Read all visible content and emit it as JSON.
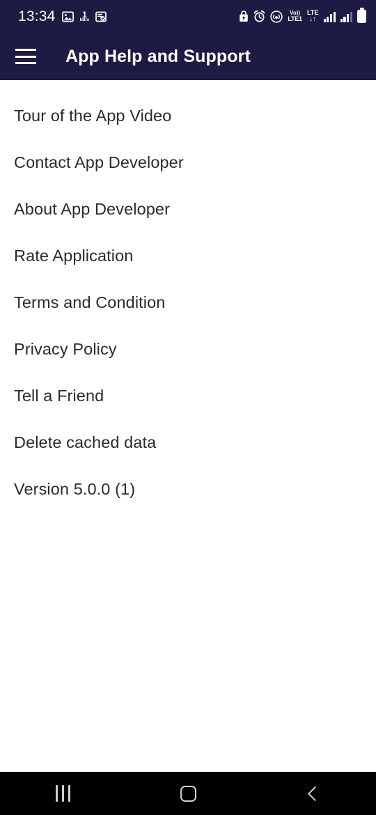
{
  "theme": {
    "header_bg": "#1d1b43",
    "header_text": "#ffffff",
    "page_bg": "#ffffff",
    "list_text": "#2b2b2b",
    "navbar_bg": "#000000",
    "navbar_icon": "#cfcfcf"
  },
  "status_bar": {
    "clock": "13:34",
    "left_icons": [
      {
        "name": "photo-icon"
      },
      {
        "name": "network-speed-indicator",
        "value": "1",
        "unit": "kB/s"
      },
      {
        "name": "document-check-icon"
      }
    ],
    "right_icons": [
      {
        "name": "lock-icon"
      },
      {
        "name": "alarm-clock-icon"
      },
      {
        "name": "hotspot-icon"
      },
      {
        "name": "volte-badge",
        "line1": "Vo))",
        "line2": "LTE1"
      },
      {
        "name": "lte-data-badge",
        "line1": "LTE",
        "line2": "↓↑"
      },
      {
        "name": "signal-bars-sim1"
      },
      {
        "name": "signal-bars-sim2"
      },
      {
        "name": "battery-icon"
      }
    ]
  },
  "app_bar": {
    "menu_label": "Menu",
    "title": "App Help and Support"
  },
  "menu_list": {
    "items": [
      {
        "label": "Tour of the App Video",
        "name": "menu-item-tour-of-the-app-video"
      },
      {
        "label": "Contact App Developer",
        "name": "menu-item-contact-app-developer"
      },
      {
        "label": "About App Developer",
        "name": "menu-item-about-app-developer"
      },
      {
        "label": "Rate Application",
        "name": "menu-item-rate-application"
      },
      {
        "label": "Terms and Condition",
        "name": "menu-item-terms-and-condition"
      },
      {
        "label": "Privacy Policy",
        "name": "menu-item-privacy-policy"
      },
      {
        "label": "Tell a Friend",
        "name": "menu-item-tell-a-friend"
      },
      {
        "label": "Delete cached data",
        "name": "menu-item-delete-cached-data"
      },
      {
        "label": "Version 5.0.0 (1)",
        "name": "app-version-label"
      }
    ]
  },
  "nav_bar": {
    "recents_label": "Recents",
    "home_label": "Home",
    "back_label": "Back"
  }
}
